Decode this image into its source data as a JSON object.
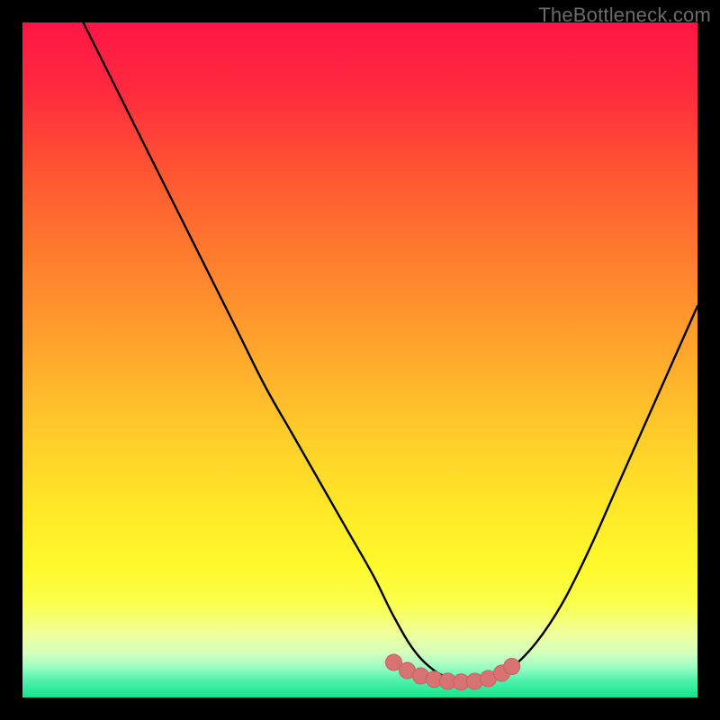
{
  "watermark": "TheBottleneck.com",
  "colors": {
    "frame": "#000000",
    "curve": "#000000",
    "marker_fill": "#d97373",
    "marker_stroke": "#c95f5f",
    "gradient_stops": [
      {
        "offset": 0.0,
        "color": "#ff1646"
      },
      {
        "offset": 0.1,
        "color": "#ff2a3e"
      },
      {
        "offset": 0.22,
        "color": "#ff5532"
      },
      {
        "offset": 0.35,
        "color": "#ff7d2e"
      },
      {
        "offset": 0.48,
        "color": "#ffa42c"
      },
      {
        "offset": 0.6,
        "color": "#ffc92a"
      },
      {
        "offset": 0.72,
        "color": "#ffe828"
      },
      {
        "offset": 0.8,
        "color": "#fff82a"
      },
      {
        "offset": 0.86,
        "color": "#fbff4a"
      },
      {
        "offset": 0.905,
        "color": "#efff9a"
      },
      {
        "offset": 0.935,
        "color": "#d3ffbe"
      },
      {
        "offset": 0.955,
        "color": "#9cfdc2"
      },
      {
        "offset": 0.975,
        "color": "#4ef2ab"
      },
      {
        "offset": 1.0,
        "color": "#17e38f"
      }
    ]
  },
  "chart_data": {
    "type": "line",
    "title": "",
    "xlabel": "",
    "ylabel": "",
    "xlim": [
      0,
      100
    ],
    "ylim": [
      0,
      100
    ],
    "grid": false,
    "legend": false,
    "series": [
      {
        "name": "bottleneck-curve",
        "x": [
          8,
          12,
          16,
          20,
          24,
          28,
          32,
          36,
          40,
          44,
          48,
          52,
          55,
          58,
          61,
          64,
          66,
          69,
          72,
          76,
          80,
          84,
          88,
          92,
          96,
          100
        ],
        "values": [
          102,
          94,
          86,
          78,
          70,
          62,
          54,
          46,
          39,
          32,
          25,
          18,
          12,
          7,
          4,
          2.5,
          2,
          2.5,
          4,
          8,
          14,
          22,
          31,
          40,
          49,
          58
        ]
      }
    ],
    "markers": {
      "name": "optimal-zone",
      "x": [
        55,
        57,
        59,
        61,
        63,
        65,
        67,
        69,
        71,
        72.5
      ],
      "values": [
        5.2,
        4.0,
        3.2,
        2.7,
        2.4,
        2.3,
        2.4,
        2.8,
        3.6,
        4.6
      ]
    }
  }
}
